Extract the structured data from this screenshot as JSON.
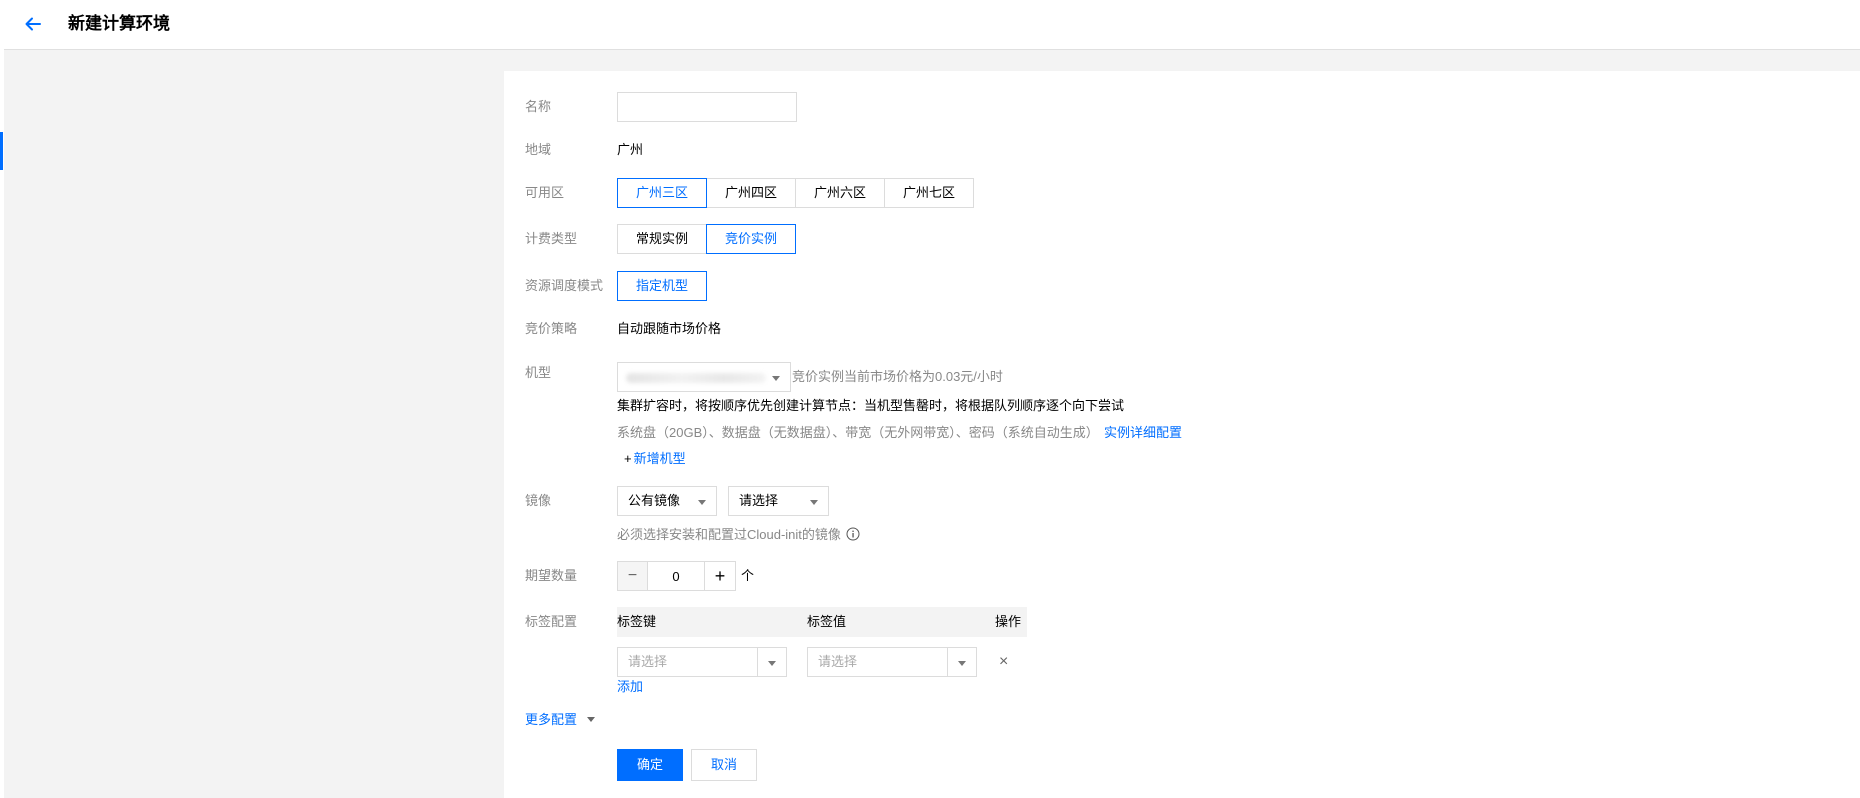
{
  "header": {
    "title": "新建计算环境"
  },
  "form": {
    "name": {
      "label": "名称",
      "value": ""
    },
    "region": {
      "label": "地域",
      "value": "广州"
    },
    "zone": {
      "label": "可用区",
      "options": [
        "广州三区",
        "广州四区",
        "广州六区",
        "广州七区"
      ],
      "selected": "广州三区"
    },
    "billing": {
      "label": "计费类型",
      "options": [
        "常规实例",
        "竞价实例"
      ],
      "selected": "竞价实例"
    },
    "scheduling": {
      "label": "资源调度模式",
      "option": "指定机型"
    },
    "bid": {
      "label": "竞价策略",
      "value": "自动跟随市场价格"
    },
    "instance": {
      "label": "机型",
      "price_note": "竞价实例当前市场价格为0.03元/小时",
      "scale_note": "集群扩容时，将按顺序优先创建计算节点：当机型售罄时，将根据队列顺序逐个向下尝试",
      "config_summary": "系统盘（20GB）、数据盘（无数据盘）、带宽（无外网带宽）、密码（系统自动生成）",
      "config_link": "实例详细配置",
      "add_plus": "+",
      "add_label": "新增机型"
    },
    "image": {
      "label": "镜像",
      "type_value": "公有镜像",
      "image_value": "请选择",
      "note": "必须选择安装和配置过Cloud-init的镜像"
    },
    "quantity": {
      "label": "期望数量",
      "minus": "−",
      "value": "0",
      "plus": "+",
      "unit": "个"
    },
    "tags": {
      "label": "标签配置",
      "col_key": "标签键",
      "col_value": "标签值",
      "col_action": "操作",
      "key_placeholder": "请选择",
      "value_placeholder": "请选择",
      "remove": "×",
      "add": "添加"
    },
    "more": "更多配置",
    "confirm": "确定",
    "cancel": "取消"
  },
  "colors": {
    "accent": "#006eff",
    "label": "#888888",
    "border": "#dcdcdc",
    "background": "#f3f3f3"
  },
  "icons": {
    "back": "arrow-left-icon",
    "info": "info-icon",
    "dropdown": "caret-down-icon",
    "remove": "close-icon"
  }
}
